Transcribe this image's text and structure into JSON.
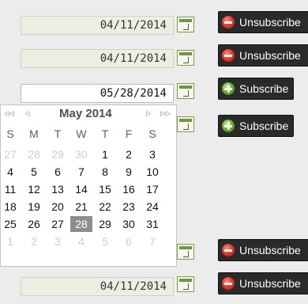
{
  "rows": [
    {
      "date": "04/11/2014",
      "action": "Unsubscribe",
      "action_type": "unsubscribe"
    },
    {
      "date": "04/11/2014",
      "action": "Unsubscribe",
      "action_type": "unsubscribe"
    },
    {
      "date": "05/28/2014",
      "action": "Subscribe",
      "action_type": "subscribe"
    },
    {
      "date": "",
      "action": "Subscribe",
      "action_type": "subscribe"
    },
    {
      "date": "",
      "action": "Unsubscribe",
      "action_type": "unsubscribe"
    },
    {
      "date": "04/11/2014",
      "action": "Unsubscribe",
      "action_type": "unsubscribe"
    }
  ],
  "calendar": {
    "month_label": "May 2014",
    "nav": {
      "prev_year": "◃◃",
      "prev_month": "◃",
      "next_month": "▹",
      "next_year": "▹▹"
    },
    "weekdays": [
      "S",
      "M",
      "T",
      "W",
      "T",
      "F",
      "S"
    ],
    "weeks": [
      [
        "27",
        "28",
        "29",
        "30",
        "1",
        "2",
        "3"
      ],
      [
        "4",
        "5",
        "6",
        "7",
        "8",
        "9",
        "10"
      ],
      [
        "11",
        "12",
        "13",
        "14",
        "15",
        "16",
        "17"
      ],
      [
        "18",
        "19",
        "20",
        "21",
        "22",
        "23",
        "24"
      ],
      [
        "25",
        "26",
        "27",
        "28",
        "29",
        "30",
        "31"
      ],
      [
        "1",
        "2",
        "3",
        "4",
        "5",
        "6",
        "7"
      ]
    ],
    "selected_day": "28"
  },
  "icons": {
    "calendar_button": "calendar-icon",
    "unsubscribe": "minus-circle-icon",
    "subscribe": "plus-circle-icon"
  },
  "colors": {
    "unsubscribe_icon": "#e83b2a",
    "subscribe_icon": "#69b52a",
    "button_bg": "#2a2a2a",
    "selected_day_bg": "#8d8d8d"
  }
}
